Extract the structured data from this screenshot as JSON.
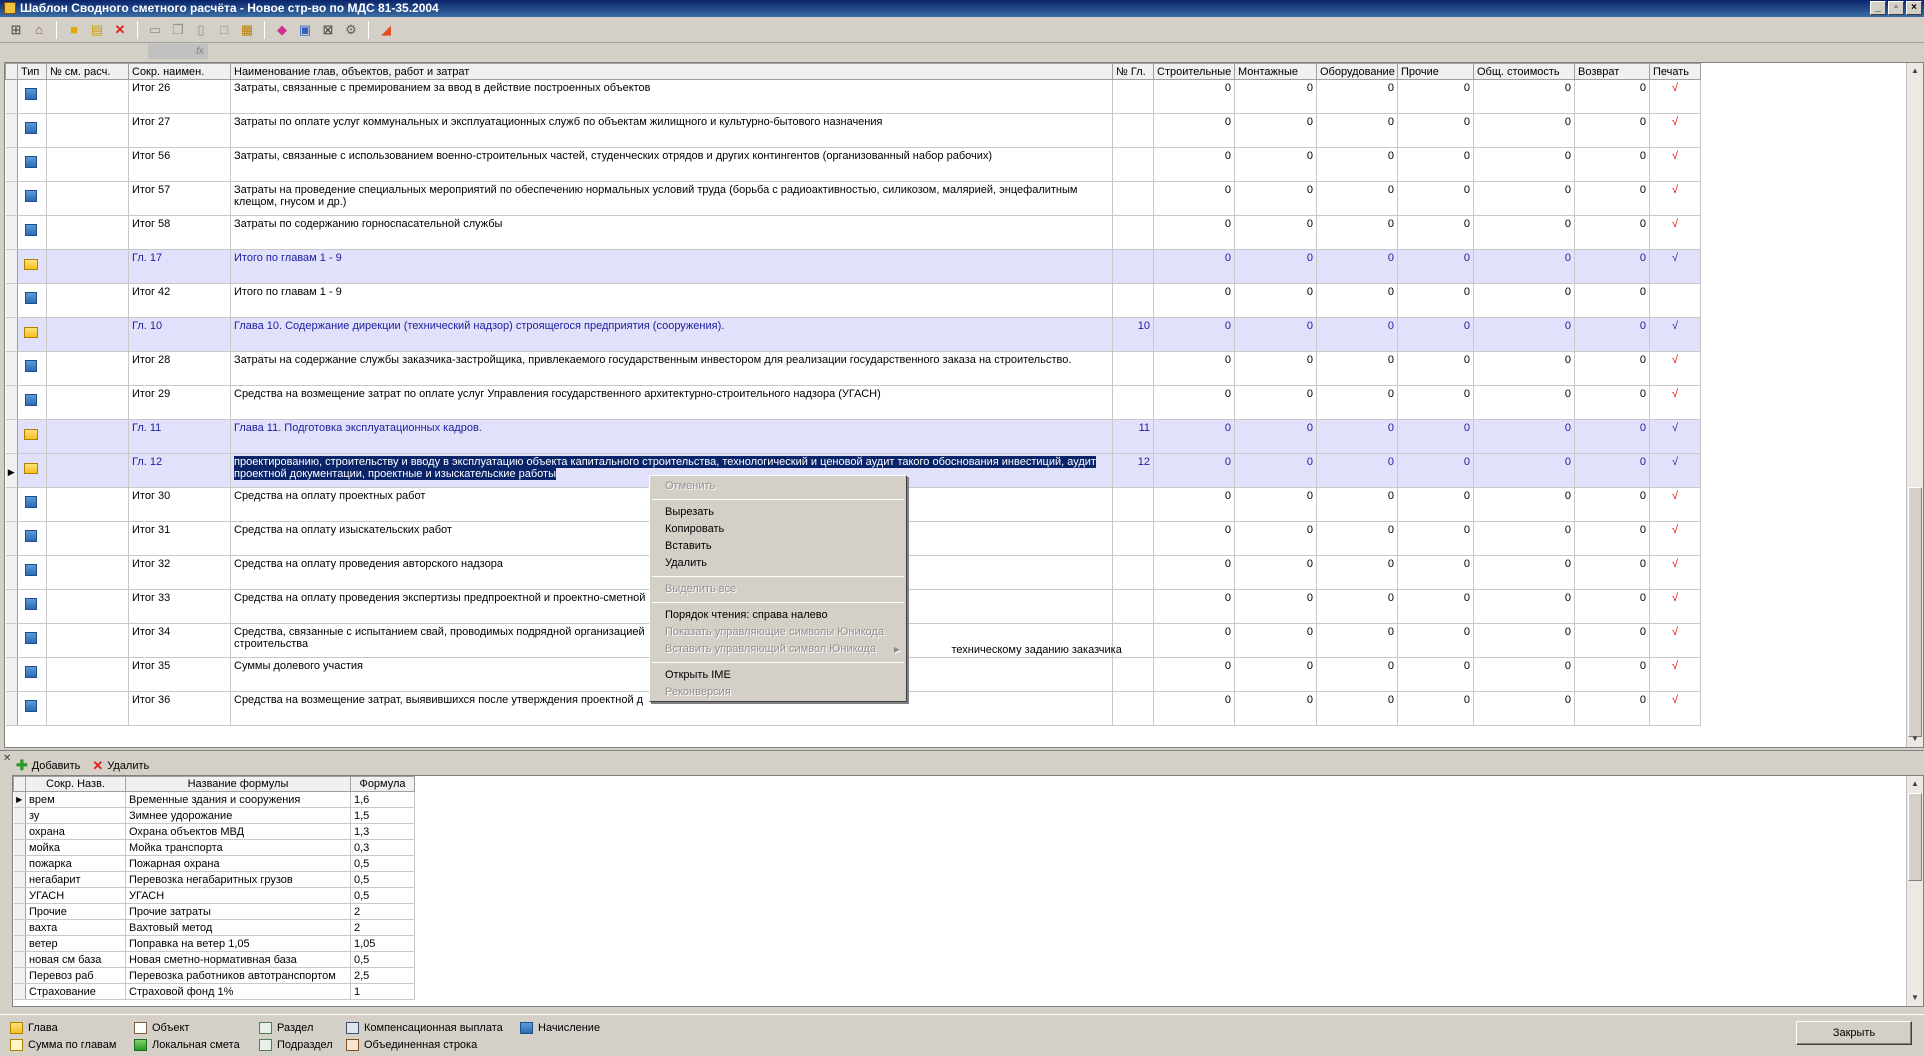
{
  "window": {
    "title": "Шаблон Сводного сметного расчёта - Новое стр-во по МДС 81-35.2004",
    "minimize": "_",
    "maximize": "▫",
    "close": "×"
  },
  "formula_bar": {
    "fx": "fx"
  },
  "grid": {
    "columns": [
      "Тип",
      "№ см. расч.",
      "Сокр. наимен.",
      "Наименование глав, объектов, работ и затрат",
      "№ Гл.",
      "Строительные",
      "Монтажные",
      "Оборудование",
      "Прочие",
      "Общ. стоимость",
      "Возврат",
      "Печать"
    ],
    "rows": [
      {
        "kind": "doc",
        "short": "Итог 26",
        "name": "Затраты, связанные с премированием за ввод в действие построенных объектов",
        "ch": "",
        "v": [
          "0",
          "0",
          "0",
          "0",
          "0",
          "0"
        ],
        "print": "√"
      },
      {
        "kind": "doc",
        "short": "Итог 27",
        "name": "Затраты  по оплате услуг коммунальных и эксплуатационных служб по объектам жилищного и культурно-бытового назначения",
        "ch": "",
        "v": [
          "0",
          "0",
          "0",
          "0",
          "0",
          "0"
        ],
        "print": "√"
      },
      {
        "kind": "doc",
        "short": "Итог 56",
        "name": "Затраты, связанные с использованием военно-строительных частей, студенческих отрядов и других контингентов (организованный набор рабочих)",
        "ch": "",
        "v": [
          "0",
          "0",
          "0",
          "0",
          "0",
          "0"
        ],
        "print": "√"
      },
      {
        "kind": "doc",
        "short": "Итог 57",
        "name": "Затраты на проведение специальных мероприятий по обеспечению нормальных условий труда (борьба с радиоактивностью, силикозом, малярией, энцефалитным клещом, гнусом и др.)",
        "ch": "",
        "v": [
          "0",
          "0",
          "0",
          "0",
          "0",
          "0"
        ],
        "print": "√"
      },
      {
        "kind": "doc",
        "short": "Итог 58",
        "name": "Затраты по содержанию горноспасательной службы",
        "ch": "",
        "v": [
          "0",
          "0",
          "0",
          "0",
          "0",
          "0"
        ],
        "print": "√"
      },
      {
        "kind": "chapter",
        "short": "Гл. 17",
        "name": "Итого по главам 1 - 9",
        "ch": "",
        "v": [
          "0",
          "0",
          "0",
          "0",
          "0",
          "0"
        ],
        "print": "√"
      },
      {
        "kind": "doc",
        "short": "Итог 42",
        "name": "Итого по главам 1 - 9",
        "ch": "",
        "v": [
          "0",
          "0",
          "0",
          "0",
          "0",
          "0"
        ],
        "print": ""
      },
      {
        "kind": "chapter",
        "short": "Гл. 10",
        "name": "Глава 10. Содержание дирекции (технический надзор) строящегося предприятия (сооружения).",
        "ch": "10",
        "v": [
          "0",
          "0",
          "0",
          "0",
          "0",
          "0"
        ],
        "print": "√"
      },
      {
        "kind": "doc",
        "short": "Итог 28",
        "name": "Затраты  на содержание службы заказчика-застройщика, привлекаемого государственным инвестором для реализации государственного заказа на строительство.",
        "ch": "",
        "v": [
          "0",
          "0",
          "0",
          "0",
          "0",
          "0"
        ],
        "print": "√"
      },
      {
        "kind": "doc",
        "short": "Итог 29",
        "name": "Средства на возмещение затрат по оплате услуг Управления государственного архитектурно-строительного надзора (УГАСН)",
        "ch": "",
        "v": [
          "0",
          "0",
          "0",
          "0",
          "0",
          "0"
        ],
        "print": "√"
      },
      {
        "kind": "chapter",
        "short": "Гл. 11",
        "name": "Глава 11. Подготовка эксплуатационных кадров.",
        "ch": "11",
        "v": [
          "0",
          "0",
          "0",
          "0",
          "0",
          "0"
        ],
        "print": "√"
      },
      {
        "kind": "chapter",
        "short": "Гл. 12",
        "name": "проектированию, строительству и вводу в эксплуатацию объекта капитального строительства, технологический и ценовой аудит такого обоснования инвестиций, аудит проектной документации, проектные и изыскательские работы",
        "ch": "12",
        "v": [
          "0",
          "0",
          "0",
          "0",
          "0",
          "0"
        ],
        "print": "√",
        "current": "▶"
      },
      {
        "kind": "doc",
        "short": "Итог 30",
        "name": "Средства на оплату проектных работ",
        "ch": "",
        "v": [
          "0",
          "0",
          "0",
          "0",
          "0",
          "0"
        ],
        "print": "√"
      },
      {
        "kind": "doc",
        "short": "Итог 31",
        "name": "Средства на оплату изыскательских работ",
        "ch": "",
        "v": [
          "0",
          "0",
          "0",
          "0",
          "0",
          "0"
        ],
        "print": "√"
      },
      {
        "kind": "doc",
        "short": "Итог 32",
        "name": "Средства на оплату проведения авторского надзора",
        "ch": "",
        "v": [
          "0",
          "0",
          "0",
          "0",
          "0",
          "0"
        ],
        "print": "√"
      },
      {
        "kind": "doc",
        "short": "Итог 33",
        "name": "Средства на оплату проведения экспертизы предпроектной и проектно-сметной",
        "ch": "",
        "v": [
          "0",
          "0",
          "0",
          "0",
          "0",
          "0"
        ],
        "print": "√"
      },
      {
        "kind": "doc",
        "short": "Итог 34",
        "name": "Средства, связанные с испытанием свай, проводимых подрядной организацией",
        "name_tail": "техническому заданию заказчика",
        "name_line2": "строительства",
        "ch": "",
        "v": [
          "0",
          "0",
          "0",
          "0",
          "0",
          "0"
        ],
        "print": "√"
      },
      {
        "kind": "doc",
        "short": "Итог 35",
        "name": "Суммы долевого участия",
        "ch": "",
        "v": [
          "0",
          "0",
          "0",
          "0",
          "0",
          "0"
        ],
        "print": "√"
      },
      {
        "kind": "doc",
        "short": "Итог 36",
        "name": "Средства на возмещение затрат, выявившихся после утверждения проектной д",
        "ch": "",
        "v": [
          "0",
          "0",
          "0",
          "0",
          "0",
          "0"
        ],
        "print": "√"
      }
    ]
  },
  "context_menu": [
    {
      "label": "Отменить",
      "disabled": true
    },
    {
      "sep": true
    },
    {
      "label": "Вырезать",
      "disabled": false
    },
    {
      "label": "Копировать",
      "disabled": false
    },
    {
      "label": "Вставить",
      "disabled": false
    },
    {
      "label": "Удалить",
      "disabled": false
    },
    {
      "sep": true
    },
    {
      "label": "Выделить все",
      "disabled": true
    },
    {
      "sep": true
    },
    {
      "label": "Порядок чтения: справа налево",
      "disabled": false
    },
    {
      "label": "Показать управляющие символы Юникода",
      "disabled": true
    },
    {
      "label": "Вставить управляющий символ Юникода",
      "disabled": true,
      "submenu": true
    },
    {
      "sep": true
    },
    {
      "label": "Открыть IME",
      "disabled": false
    },
    {
      "label": "Реконверсия",
      "disabled": true
    }
  ],
  "bottom": {
    "add_label": "Добавить",
    "delete_label": "Удалить",
    "columns": [
      "Сокр. Назв.",
      "Название формулы",
      "Формула"
    ],
    "rows": [
      {
        "short": "врем",
        "name": "Временные здания и сооружения",
        "formula": "1,6"
      },
      {
        "short": "зу",
        "name": "Зимнее удорожание",
        "formula": "1,5"
      },
      {
        "short": "охрана",
        "name": "Охрана объектов МВД",
        "formula": "1,3"
      },
      {
        "short": "мойка",
        "name": "Мойка транспорта",
        "formula": "0,3"
      },
      {
        "short": "пожарка",
        "name": "Пожарная охрана",
        "formula": "0,5"
      },
      {
        "short": "негабарит",
        "name": "Перевозка негабаритных грузов",
        "formula": "0,5"
      },
      {
        "short": "УГАСН",
        "name": "УГАСН",
        "formula": "0,5"
      },
      {
        "short": "Прочие",
        "name": "Прочие затраты",
        "formula": "2"
      },
      {
        "short": "вахта",
        "name": "Вахтовый метод",
        "formula": "2"
      },
      {
        "short": "ветер",
        "name": "Поправка на ветер 1,05",
        "formula": "1,05"
      },
      {
        "short": "новая см база",
        "name": "Новая сметно-нормативная база",
        "formula": "0,5"
      },
      {
        "short": "Перевоз раб",
        "name": "Перевозка работников автотранспортом",
        "formula": "2,5"
      },
      {
        "short": "Страхование",
        "name": "Страховой фонд 1%",
        "formula": "1"
      }
    ]
  },
  "legend": {
    "glava": "Глава",
    "summa": "Сумма по главам",
    "object": "Объект",
    "local": "Локальная смета",
    "razdel": "Раздел",
    "podrazdel": "Подраздел",
    "komp": "Компенсационная выплата",
    "union": "Объединенная строка",
    "charge": "Начисление"
  },
  "close_label": "Закрыть"
}
